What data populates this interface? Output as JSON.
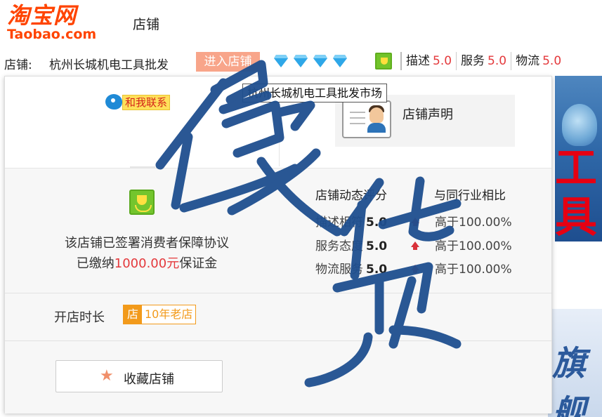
{
  "header": {
    "logo_cn": "淘宝网",
    "logo_en": "Taobao.com",
    "title": "店铺"
  },
  "shopbar": {
    "shop_label": "店铺:",
    "shop_name": "杭州长城机电工具批发",
    "enter_button": "进入店铺",
    "diamond_count": 4,
    "ratings": [
      {
        "label": "描述",
        "value": "5.0"
      },
      {
        "label": "服务",
        "value": "5.0"
      },
      {
        "label": "物流",
        "value": "5.0"
      }
    ]
  },
  "banner": {
    "top_text": "工具",
    "bottom_text": "旗舰"
  },
  "card": {
    "contact_label": "和我联系",
    "tooltip": "杭州长城机电工具批发市场",
    "notice_label": "店铺声明",
    "guarantee_line1": "该店铺已签署消费者保障协议",
    "guarantee_line2_prefix": "已缴纳",
    "guarantee_deposit": "1000.00元",
    "guarantee_line2_suffix": "保证金",
    "dsr_header": "店铺动态评分",
    "compare_header": "与同行业相比",
    "dsr_rows": [
      {
        "label": "描述相符",
        "score": "5.0",
        "compare": "高于100.00%"
      },
      {
        "label": "服务态度",
        "score": "5.0",
        "compare": "高于100.00%"
      },
      {
        "label": "物流服务",
        "score": "5.0",
        "compare": "高于100.00%"
      }
    ],
    "open_label": "开店时长",
    "age_icon": "店",
    "age_text": "10年老店",
    "favorite_button": "收藏店铺"
  },
  "watermark": {
    "text": "假货",
    "color": "#1f4f8f"
  },
  "colors": {
    "brand": "#ff4400",
    "accent_red": "#e4393c",
    "diamond": "#2ea7e8",
    "age_badge": "#f29a1b",
    "enter_button_bg": "#f8a58a"
  },
  "icons": [
    "taobao-logo",
    "diamond-icon",
    "shield-icon",
    "wangwang-icon",
    "notice-id-card-icon",
    "arrow-up-icon",
    "star-icon"
  ]
}
